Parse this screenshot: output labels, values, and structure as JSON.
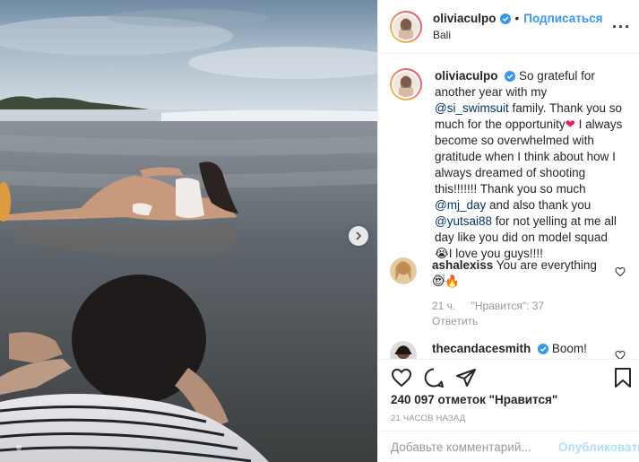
{
  "post": {
    "author": "oliviaculpo",
    "separator": "•",
    "follow_label": "Подписаться",
    "location": "Bali",
    "more_icon": "ellipsis-icon",
    "caption_parts": {
      "p1": "So grateful for another year with my ",
      "mention1": "@si_swimsuit",
      "p2": " family. Thank you so much for the opportunity",
      "heart": "❤",
      "p3": " I always become so overwhelmed with gratitude when I think about how I always dreamed of shooting this!!!!!!! Thank you so much ",
      "mention2": "@mj_day",
      "p4": " and also thank you ",
      "mention3": "@yutsai88",
      "p5": " for not yelling at me all day like you did on model squad ",
      "emoji": "😭",
      "p6": "⁣I love you guys!!!!"
    },
    "caption_time": "21 ч.",
    "comments": [
      {
        "user": "ashalexiss",
        "text": "You are everything",
        "emoji": "😍🔥",
        "time": "21 ч.",
        "likes": "\"Нравится\": 37",
        "reply": "Ответить"
      },
      {
        "user": "thecandacesmith",
        "text": "Boom!"
      }
    ],
    "likes_text": "240 097 отметок \"Нравится\"",
    "time_ago": "21 ЧАСОВ НАЗАД",
    "comment_placeholder": "Добавьте комментарий...",
    "publish_label": "Опубликовать",
    "colors": {
      "accent": "#3897f0",
      "secondary_text": "#999999",
      "mention": "#003569",
      "verified": "#3897f0"
    }
  }
}
